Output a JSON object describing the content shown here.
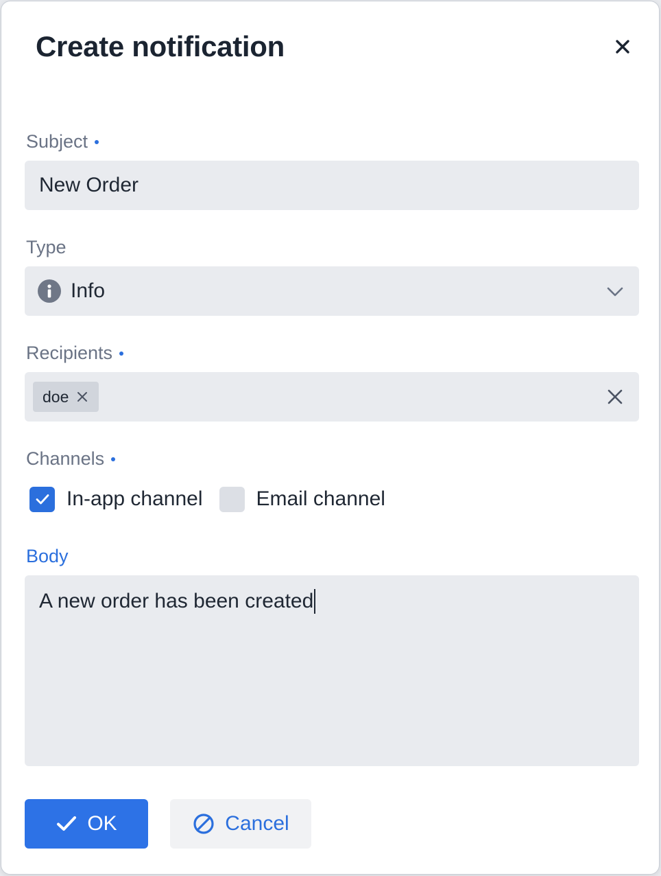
{
  "dialog": {
    "title": "Create notification",
    "close_icon": "close-icon"
  },
  "subject": {
    "label": "Subject",
    "required": true,
    "value": "New Order"
  },
  "type": {
    "label": "Type",
    "selected": "Info",
    "icon": "info-circle-icon",
    "dropdown_icon": "chevron-down-icon"
  },
  "recipients": {
    "label": "Recipients",
    "required": true,
    "tags": [
      "doe"
    ],
    "clear_icon": "clear-icon"
  },
  "channels": {
    "label": "Channels",
    "required": true,
    "options": [
      {
        "label": "In-app channel",
        "checked": true
      },
      {
        "label": "Email channel",
        "checked": false
      }
    ]
  },
  "body": {
    "label": "Body",
    "value": "A new order has been created"
  },
  "actions": {
    "ok_label": "OK",
    "ok_icon": "check-icon",
    "cancel_label": "Cancel",
    "cancel_icon": "ban-icon"
  },
  "colors": {
    "accent": "#2d72e6",
    "field_background": "#e9ebef",
    "label_text": "#6a7385"
  }
}
